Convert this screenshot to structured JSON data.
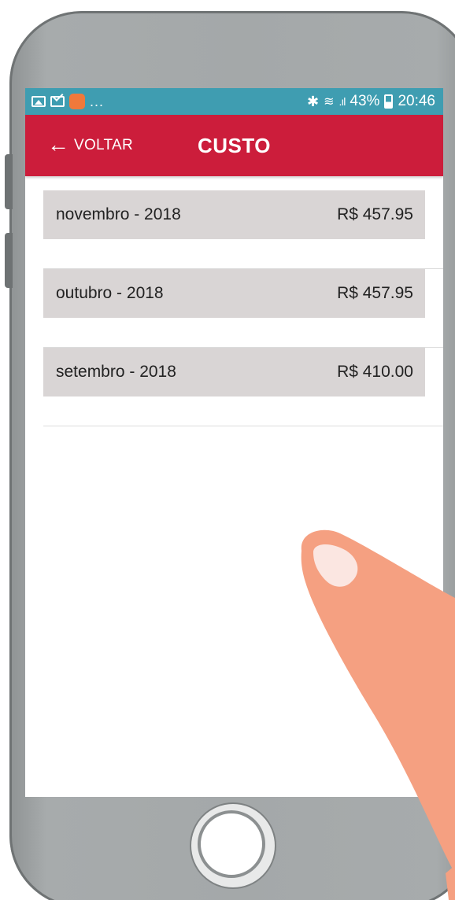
{
  "statusbar": {
    "left_icons": [
      "image-icon",
      "mail-icon",
      "app-notification-icon"
    ],
    "ellipsis": "...",
    "bluetooth_symbol": "✱",
    "wifi_symbol": "≋",
    "signal_symbol": ".ıl",
    "battery": "43%",
    "time": "20:46"
  },
  "appbar": {
    "back_arrow": "←",
    "back_label": "VOLTAR",
    "title": "CUSTO",
    "color": "#cc1d3b"
  },
  "list": {
    "items": [
      {
        "label": "novembro - 2018",
        "amount": "R$ 457.95"
      },
      {
        "label": "outubro - 2018",
        "amount": "R$ 457.95"
      },
      {
        "label": "setembro - 2018",
        "amount": "R$ 410.00"
      }
    ]
  },
  "colors": {
    "statusbar": "#3f9db1",
    "card": "#d9d5d5",
    "phone": "#a4a8a9",
    "hand": "#f5a081"
  }
}
